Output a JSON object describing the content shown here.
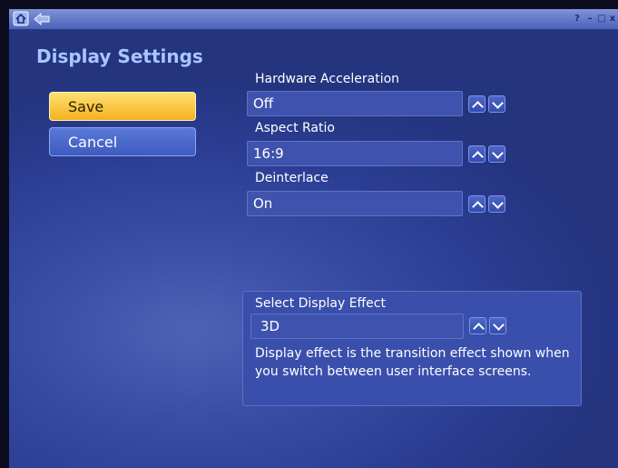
{
  "window": {
    "controls": {
      "help_glyph": "?",
      "minimize_glyph": "–",
      "maximize_glyph": "□",
      "close_glyph": "x"
    }
  },
  "page": {
    "title": "Display Settings"
  },
  "actions": {
    "save_label": "Save",
    "cancel_label": "Cancel"
  },
  "settings": [
    {
      "label": "Hardware Acceleration",
      "value": "Off"
    },
    {
      "label": "Aspect Ratio",
      "value": "16:9"
    },
    {
      "label": "Deinterlace",
      "value": "On"
    }
  ],
  "display_effect": {
    "title": "Select Display Effect",
    "value": "3D",
    "description": "Display effect is the transition effect shown when you switch between user interface screens."
  },
  "icons": {
    "home": "home-icon",
    "back": "back-arrow-icon",
    "up": "chevron-up-icon",
    "down": "chevron-down-icon"
  },
  "colors": {
    "background": "#2c3e94",
    "title_text": "#a9c6ff",
    "save_button": "#f4b21e",
    "cancel_button": "#3e5bc0"
  }
}
